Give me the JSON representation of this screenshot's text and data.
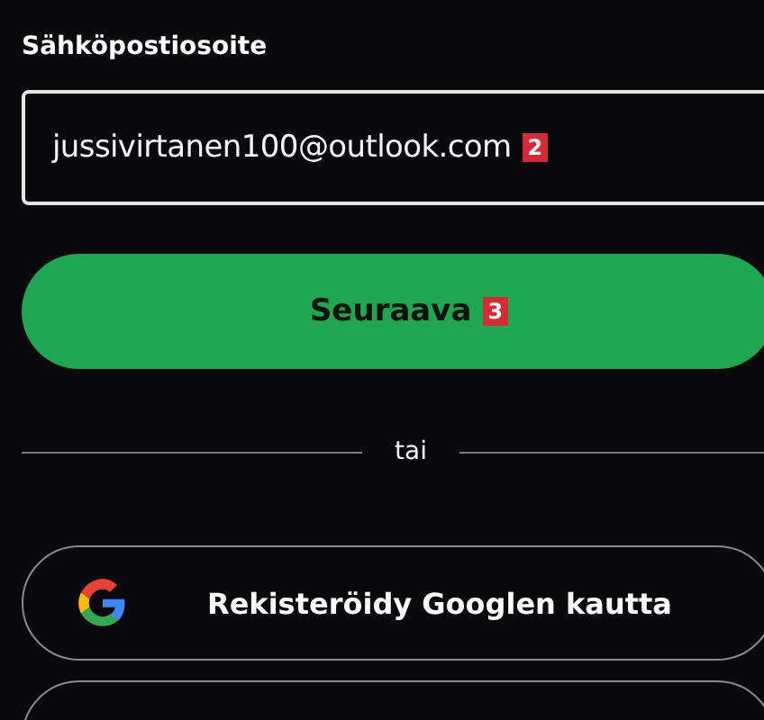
{
  "email_field": {
    "label": "Sähköpostiosoite",
    "value": "jussivirtanen100@outlook.com",
    "badge": "2"
  },
  "next_button": {
    "label": "Seuraava",
    "badge": "3"
  },
  "divider": {
    "text": "tai"
  },
  "social_buttons": [
    {
      "kind": "google",
      "label": "Rekisteröidy Googlen kautta"
    },
    {
      "kind": "blank"
    }
  ]
}
